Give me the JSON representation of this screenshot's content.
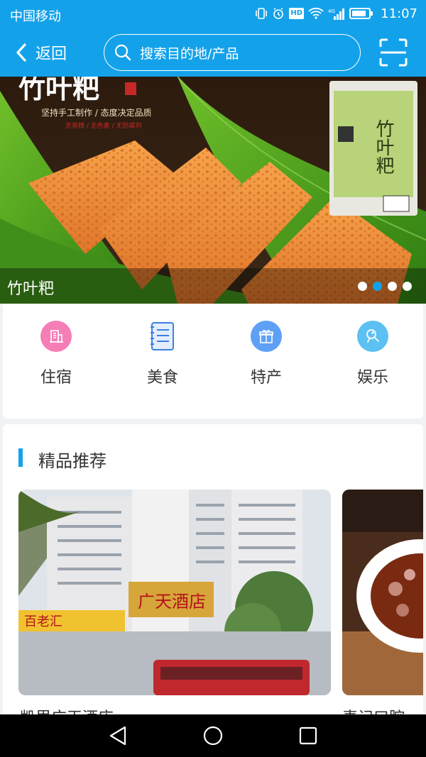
{
  "status_bar": {
    "carrier": "中国移动",
    "hd": "HD",
    "network": "4G",
    "time": "11:07",
    "battery_level": 0.85
  },
  "header": {
    "back_label": "返回",
    "search_placeholder": "搜索目的地/产品",
    "icons": [
      "back-chevron-icon",
      "search-icon",
      "scan-icon"
    ]
  },
  "banner": {
    "caption": "竹叶粑",
    "image_text": "竹叶粑",
    "image_slogan": "坚持手工制作 / 态度决定品质",
    "image_sub": "无香精 / 无色素 / 无防腐剂",
    "package_text": "竹叶粑",
    "dots_count": 4,
    "active_dot": 1
  },
  "categories": [
    {
      "label": "住宿",
      "icon": "hotel-icon",
      "color": "#f57eb6"
    },
    {
      "label": "美食",
      "icon": "notebook-icon",
      "color": "#3d7fe0"
    },
    {
      "label": "特产",
      "icon": "gift-icon",
      "color": "#5ea0f5"
    },
    {
      "label": "娱乐",
      "icon": "entertainment-icon",
      "color": "#5cc1f2"
    }
  ],
  "recommend": {
    "title": "精品推荐",
    "items": [
      {
        "name": "凯里广天酒店",
        "sign_main": "广天酒店",
        "sign_left": "百老汇"
      },
      {
        "name": "麦记口腔"
      }
    ]
  },
  "colors": {
    "primary": "#13a2ea"
  }
}
